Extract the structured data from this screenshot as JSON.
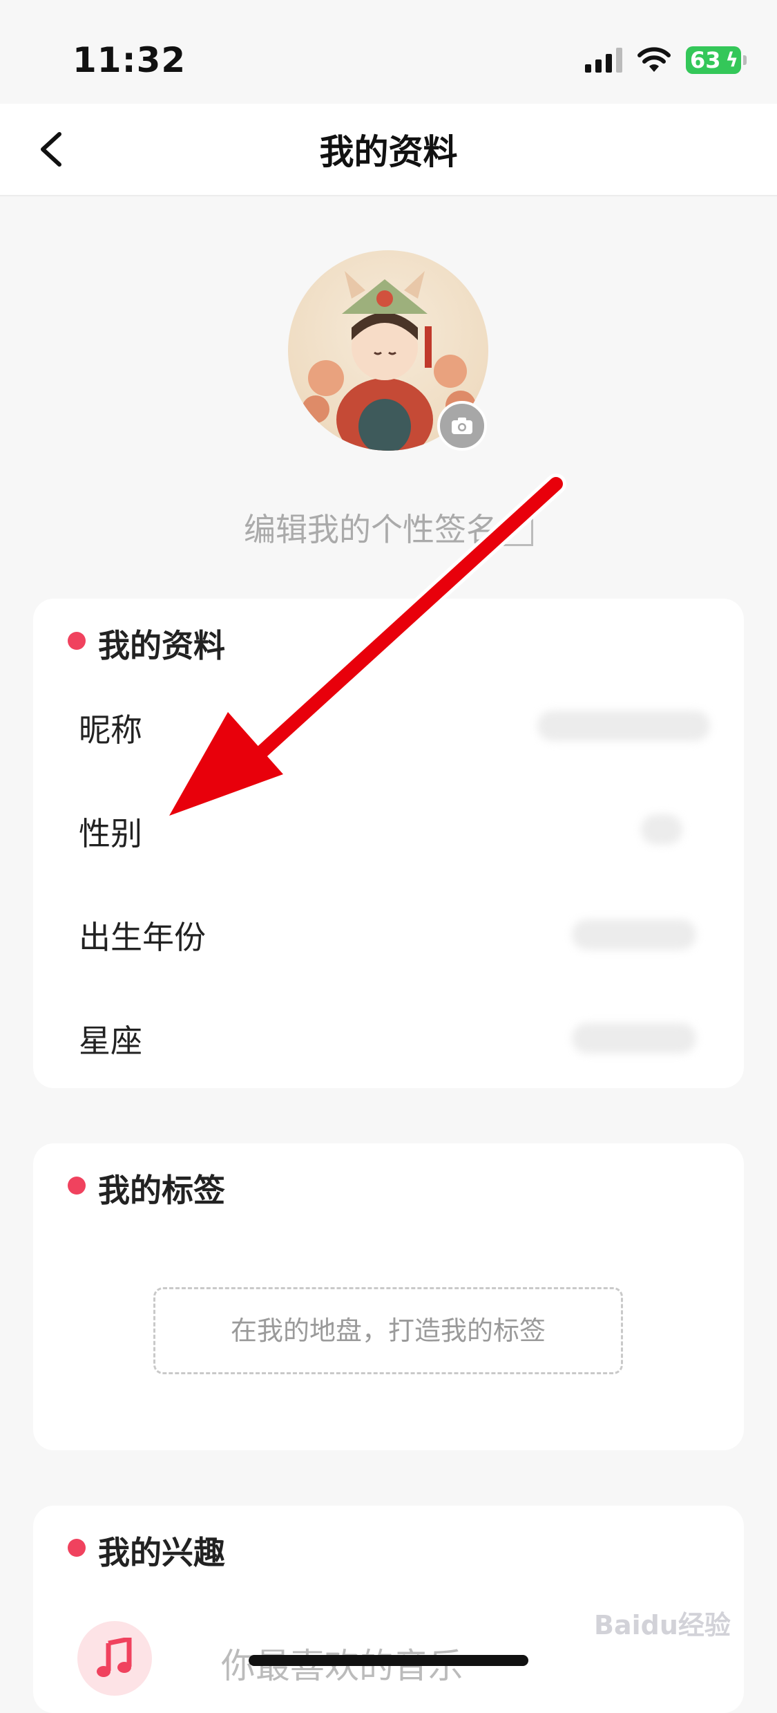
{
  "status_bar": {
    "time": "11:32",
    "battery": "63"
  },
  "header": {
    "title": "我的资料"
  },
  "profile": {
    "signature_placeholder": "编辑我的个性签名"
  },
  "sections": {
    "info": {
      "title": "我的资料",
      "rows": [
        {
          "label": "昵称"
        },
        {
          "label": "性别"
        },
        {
          "label": "出生年份"
        },
        {
          "label": "星座"
        }
      ]
    },
    "tags": {
      "title": "我的标签",
      "placeholder": "在我的地盘，打造我的标签"
    },
    "interests": {
      "title": "我的兴趣",
      "music_label": "你最喜欢的音乐"
    }
  },
  "watermark": "Baidu经验",
  "colors": {
    "accent": "#f0425e",
    "arrow": "#e8000b",
    "battery": "#34c759"
  }
}
